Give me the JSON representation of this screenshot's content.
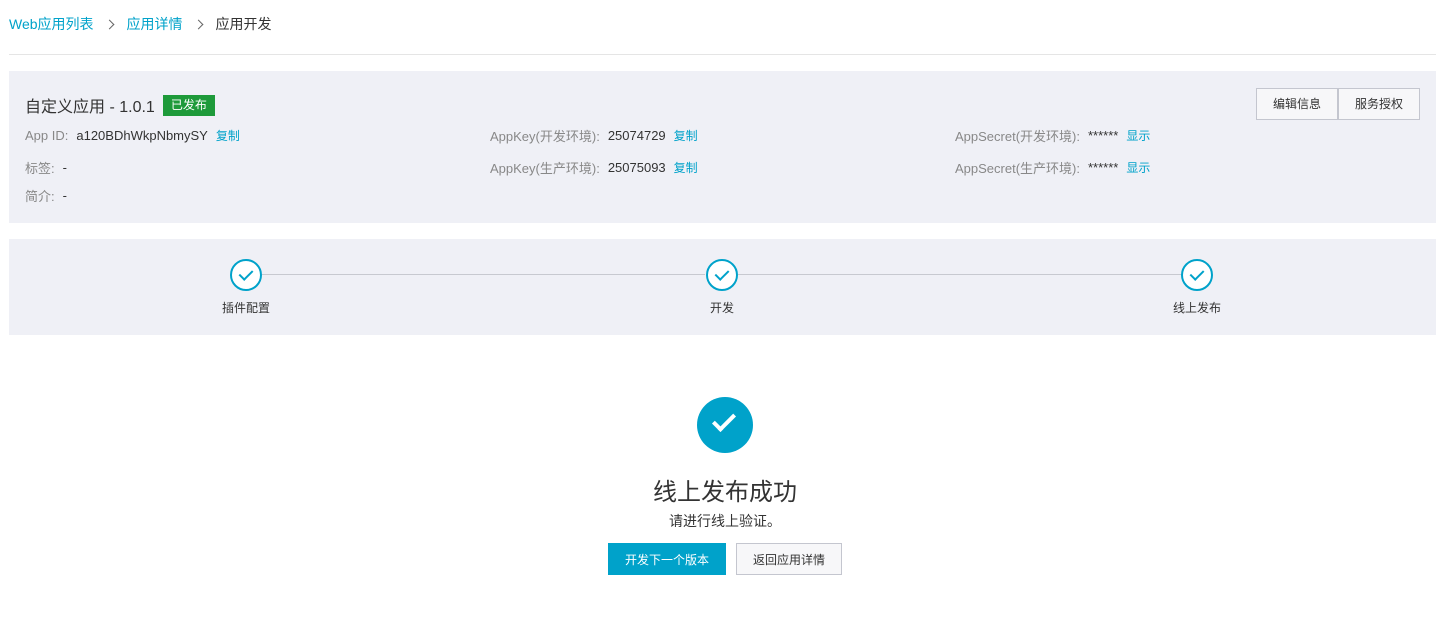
{
  "breadcrumb": {
    "items": [
      "Web应用列表",
      "应用详情"
    ],
    "current": "应用开发"
  },
  "app": {
    "title": "自定义应用 - 1.0.1",
    "status": "已发布",
    "buttons": {
      "edit": "编辑信息",
      "auth": "服务授权"
    },
    "fields": {
      "app_id": {
        "label": "App ID:",
        "value": "a120BDhWkpNbmySY",
        "action": "复制"
      },
      "tag": {
        "label": "标签:",
        "value": "-"
      },
      "intro": {
        "label": "简介:",
        "value": "-"
      },
      "appkey_dev": {
        "label": "AppKey(开发环境):",
        "value": "25074729",
        "action": "复制"
      },
      "appkey_prod": {
        "label": "AppKey(生产环境):",
        "value": "25075093",
        "action": "复制"
      },
      "secret_dev": {
        "label": "AppSecret(开发环境):",
        "value": "******",
        "action": "显示"
      },
      "secret_prod": {
        "label": "AppSecret(生产环境):",
        "value": "******",
        "action": "显示"
      }
    }
  },
  "steps": [
    {
      "label": "插件配置",
      "status": "done"
    },
    {
      "label": "开发",
      "status": "done"
    },
    {
      "label": "线上发布",
      "status": "done"
    }
  ],
  "result": {
    "icon": "check-circle-icon",
    "title": "线上发布成功",
    "description": "请进行线上验证。",
    "primary_action": "开发下一个版本",
    "secondary_action": "返回应用详情"
  },
  "colors": {
    "accent": "#00a2ca",
    "success_badge": "#1e9a3a",
    "panel_bg": "#eff0f6"
  }
}
